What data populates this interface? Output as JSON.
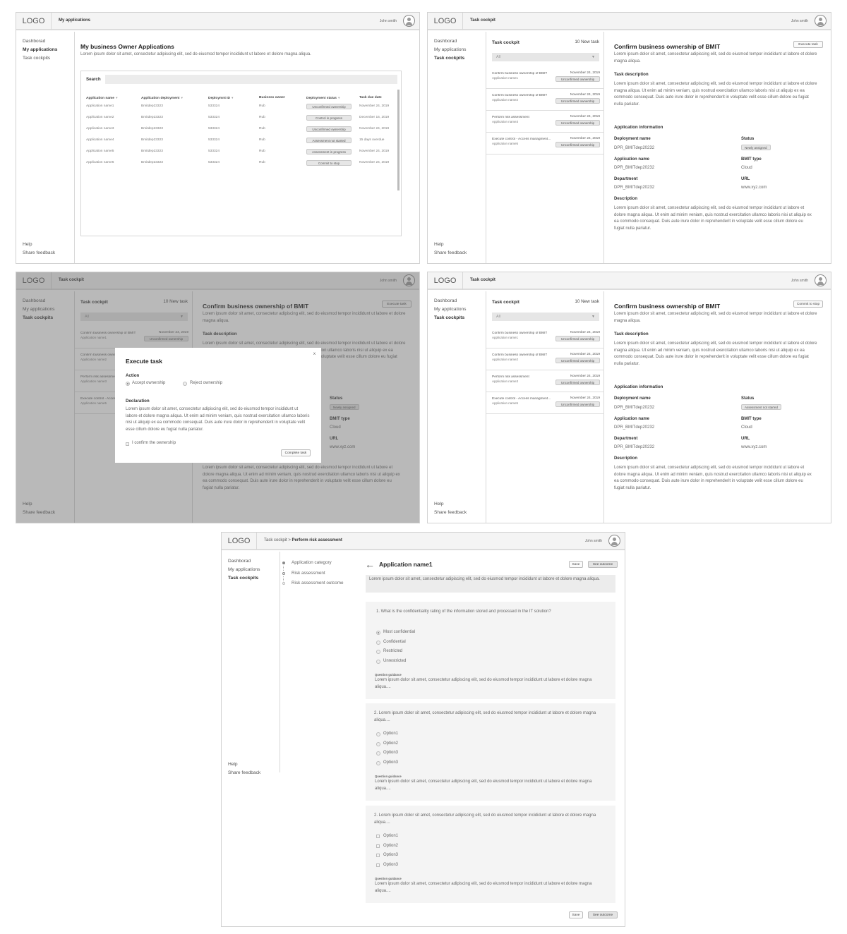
{
  "common": {
    "logo": "LOGO",
    "user": "John smith",
    "nav": {
      "dashboard": "Dashborad",
      "my_apps": "My applications",
      "task_cockpits": "Task cockpits"
    },
    "help": "Help",
    "feedback": "Share feedback"
  },
  "screen1": {
    "crumb": "My applications",
    "title": "My business Owner Applications",
    "subtitle": "Lorem ipsum dolor sit amet, consectetur adipiscing elit, sed do eiusmod tempor incididunt ut labore et dolore magna aliqua.",
    "search_label": "Search",
    "columns": [
      "Application name",
      "Application deployment",
      "Deploymnt ID",
      "Business owner",
      "Deployment status",
      "Task due date"
    ],
    "rows": [
      [
        "Application name1",
        "Bmitdep23323",
        "533324",
        "Rub",
        "Unconfirmed ownership",
        "November 24, 2019"
      ],
      [
        "Application name2",
        "Bmitdep23323",
        "533324",
        "Rub",
        "Control in progress",
        "December 16, 2019"
      ],
      [
        "Application name3",
        "Bmitdep23323",
        "533324",
        "Rub",
        "Unconfirmed ownership",
        "November 24, 2019"
      ],
      [
        "Application name4",
        "Bmitdep23323",
        "533324",
        "Rub",
        "Assessment not started",
        "15 days overdue"
      ],
      [
        "Application name5",
        "Bmitdep23323",
        "533324",
        "Rub",
        "Assessment in progress",
        "November 24, 2019"
      ],
      [
        "Application name6",
        "Bmitdep23323",
        "533324",
        "Rub",
        "Commit to stop",
        "November 24, 2019"
      ]
    ]
  },
  "cockpit": {
    "crumb": "Task cockpit",
    "panel_title": "Task cockpit",
    "new_count": "10 New task",
    "filter": "All",
    "tasks": [
      {
        "name": "Confirm business ownership of BMIT",
        "app": "Application name1",
        "date": "November 24, 2019",
        "status": "Unconfirmed ownership"
      },
      {
        "name": "Confirm business ownership of BMIT",
        "app": "Application name2",
        "date": "November 24, 2019",
        "status": "Unconfirmed ownership"
      },
      {
        "name": "Perform risk assessment",
        "app": "Application name3",
        "date": "November 24, 2019",
        "status": "Unconfirmed ownership"
      },
      {
        "name": "Execute control - Access managment...",
        "app": "Application name5",
        "date": "November 24, 2019",
        "status": "Unconfirmed ownership"
      }
    ],
    "detail_title": "Confirm business ownership of BMIT",
    "detail_sub": "Lorem ipsum dolor sit amet, consectetur adipiscing elit, sed do eiusmod tempor incididunt ut labore et dolore magna aliqua.",
    "task_desc_h": "Task description",
    "task_desc": "Lorem ipsum dolor sit amet, consectetur adipiscing elit, sed do eiusmod tempor incididunt ut labore et dolore magna aliqua. Ut enim ad minim veniam, quis nostrud exercitation ullamco laboris nisi ut aliquip ex ea commodo consequat. Duis aute irure dolor in reprehenderit in voluptate velit esse cillum dolore eu fugiat nulla pariatur.",
    "app_info_h": "Application information",
    "dep_name_l": "Deployment name",
    "dep_name_v": "DPR_BMITdep20232",
    "status_l": "Status",
    "app_name_l": "Application name",
    "app_name_v": "DPR_BMITdep20232",
    "bmit_l": "BMIT type",
    "bmit_v": "Cloud",
    "dept_l": "Department",
    "dept_v": "DPR_BMITdep20232",
    "url_l": "URL",
    "url_v": "www.xyz.com",
    "desc_l": "Description",
    "desc_v": "Lorem ipsum dolor sit amet, consectetur adipiscing elit, sed do eiusmod tempor incididunt ut labore et dolore magna aliqua. Ut enim ad minim veniam, quis nostrud exercitation ullamco laboris nisi ut aliquip ex ea commodo consequat. Duis aute irure dolor in reprehenderit in voluptate velit esse cillum dolore eu fugiat nulla pariatur."
  },
  "screen2": {
    "action_btn": "Execute task",
    "status_v": "Newly assigned"
  },
  "screen4": {
    "action_btn": "Commit to stop",
    "status_v": "Assessment not started"
  },
  "modal": {
    "title": "Execute task",
    "close": "x",
    "action_h": "Action",
    "accept": "Accept ownership",
    "reject": "Reject ownership",
    "decl_h": "Declaration",
    "decl": "Lorem ipsum dolor sit amet, consectetur adipiscing elit, sed do eiusmod tempor incididunt ut labore et dolore magna aliqua. Ut enim ad minim veniam, quis nostrud exercitation ullamco laboris nisi ut aliquip ex ea commodo consequat. Duis aute irure dolor in reprehenderit in voluptate velit esse cillum dolore eu fugiat nulla pariatur.",
    "confirm": "I confirm the ownership",
    "complete": "Complete task"
  },
  "screen5": {
    "crumb_prefix": "Task cockpit > ",
    "crumb_page": "Perform risk assessment",
    "steps": [
      "Application category",
      "Risk assessment",
      "Risk assessment outcome"
    ],
    "title": "Application name1",
    "save": "Save",
    "outcome": "See outcome",
    "intro": "Lorem ipsum dolor sit amet, consectetur adipiscing elit, sed do eiusmod tempor incididunt ut labore et dolore magna aliqua.",
    "q1": "1. What is the confidentiality rating of the information stored and processed in the IT solution?",
    "q1_opts": [
      "Most confidential",
      "Confidential",
      "Restricted",
      "Unrestricted"
    ],
    "guidance_h": "Question guidance",
    "guidance": "Lorem ipsum dolor sit amet, consectetur adipiscing elit, sed do eiusmod tempor incididunt ut labore et dolore magna aliqua....",
    "q2": "2. Lorem ipsum dolor sit amet, consectetur adipiscing elit, sed do eiusmod tempor incididunt ut labore et dolore magna aliqua....",
    "q_opts": [
      "Option1",
      "Option2",
      "Option3",
      "Option3"
    ]
  }
}
